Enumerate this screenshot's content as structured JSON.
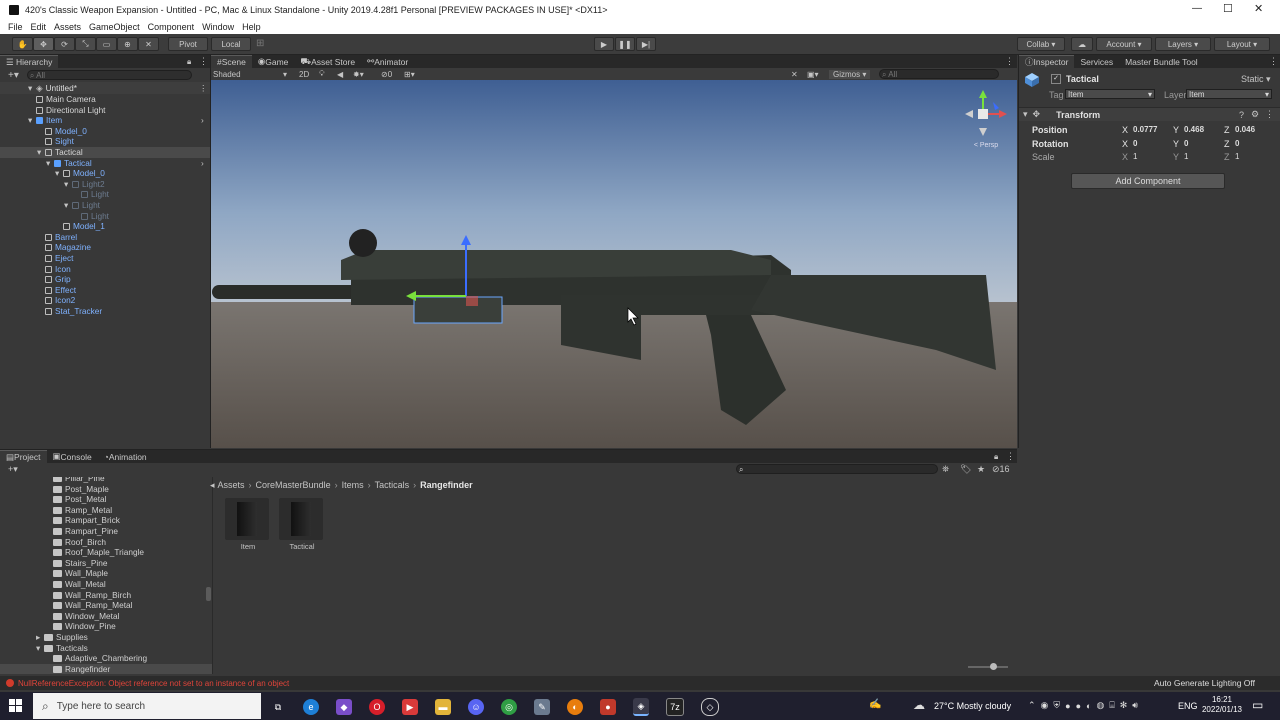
{
  "window": {
    "title": "420's Classic Weapon Expansion - Untitled - PC, Mac & Linux Standalone - Unity 2019.4.28f1 Personal [PREVIEW PACKAGES IN USE]* <DX11>",
    "controls": {
      "minimize": "—",
      "maximize": "☐",
      "close": "✕"
    }
  },
  "menu": [
    "File",
    "Edit",
    "Assets",
    "GameObject",
    "Component",
    "Window",
    "Help"
  ],
  "toolbar": {
    "pivot": "Pivot",
    "local": "Local",
    "collab": "Collab ▾",
    "services": "☁",
    "account": "Account",
    "layers": "Layers",
    "layout": "Layout"
  },
  "hierarchy": {
    "tab": "Hierarchy",
    "search_placeholder": "All",
    "scene": "Untitled*",
    "items": [
      {
        "label": "Main Camera",
        "indent": 1,
        "color": "white",
        "icon": "camera"
      },
      {
        "label": "Directional Light",
        "indent": 1,
        "color": "white",
        "icon": "cube"
      },
      {
        "label": "Item",
        "indent": 1,
        "color": "blue",
        "icon": "prefab",
        "expand": "▾",
        "arrow": "›"
      },
      {
        "label": "Model_0",
        "indent": 2,
        "color": "blue",
        "icon": "cube"
      },
      {
        "label": "Sight",
        "indent": 2,
        "color": "blue",
        "icon": "cube"
      },
      {
        "label": "Tactical",
        "indent": 2,
        "color": "white",
        "icon": "cube",
        "expand": "▾",
        "selected": true
      },
      {
        "label": "Tactical",
        "indent": 3,
        "color": "blue",
        "icon": "prefab",
        "expand": "▾",
        "arrow": "›"
      },
      {
        "label": "Model_0",
        "indent": 4,
        "color": "blue",
        "icon": "cube",
        "expand": "▾"
      },
      {
        "label": "Light2",
        "indent": 5,
        "color": "dim",
        "icon": "cube",
        "expand": "▾"
      },
      {
        "label": "Light",
        "indent": 6,
        "color": "dim",
        "icon": "cube"
      },
      {
        "label": "Light",
        "indent": 5,
        "color": "dim",
        "icon": "cube",
        "expand": "▾"
      },
      {
        "label": "Light",
        "indent": 6,
        "color": "dim",
        "icon": "cube"
      },
      {
        "label": "Model_1",
        "indent": 4,
        "color": "blue",
        "icon": "cube"
      },
      {
        "label": "Barrel",
        "indent": 2,
        "color": "blue",
        "icon": "cube"
      },
      {
        "label": "Magazine",
        "indent": 2,
        "color": "blue",
        "icon": "cube"
      },
      {
        "label": "Eject",
        "indent": 2,
        "color": "blue",
        "icon": "cube"
      },
      {
        "label": "Icon",
        "indent": 2,
        "color": "blue",
        "icon": "cube"
      },
      {
        "label": "Grip",
        "indent": 2,
        "color": "blue",
        "icon": "cube"
      },
      {
        "label": "Effect",
        "indent": 2,
        "color": "blue",
        "icon": "cube"
      },
      {
        "label": "Icon2",
        "indent": 2,
        "color": "blue",
        "icon": "cube"
      },
      {
        "label": "Stat_Tracker",
        "indent": 2,
        "color": "blue",
        "icon": "cube"
      }
    ]
  },
  "scene": {
    "tabs": [
      "Scene",
      "Game",
      "Asset Store",
      "Animator"
    ],
    "shading": "Shaded",
    "mode_2d": "2D",
    "fx_count": "0",
    "gizmos": "Gizmos",
    "search_placeholder": "All",
    "persp": "< Persp",
    "gizmo_axes": {
      "x": "x",
      "y": "y",
      "z": "z"
    }
  },
  "inspector": {
    "tabs": [
      "Inspector",
      "Services",
      "Master Bundle Tool"
    ],
    "object_name": "Tactical",
    "static_label": "Static ▾",
    "tag_label": "Tag",
    "tag_value": "Item",
    "layer_label": "Layer",
    "layer_value": "Item",
    "component": "Transform",
    "position": {
      "label": "Position",
      "x": "0.0777",
      "y": "0.468",
      "z": "0.046"
    },
    "rotation": {
      "label": "Rotation",
      "x": "0",
      "y": "0",
      "z": "0"
    },
    "scale": {
      "label": "Scale",
      "x": "1",
      "y": "1",
      "z": "1"
    },
    "axis_labels": {
      "x": "X",
      "y": "Y",
      "z": "Z"
    },
    "add_component": "Add Component"
  },
  "project": {
    "tabs": [
      "Project",
      "Console",
      "Animation"
    ],
    "breadcrumb": [
      "Assets",
      "CoreMasterBundle",
      "Items",
      "Tacticals",
      "Rangefinder"
    ],
    "breadcrumb_sep": "›",
    "hidden_count": "16",
    "folders": [
      {
        "label": "Pillar_Pine",
        "indent": 2
      },
      {
        "label": "Post_Maple",
        "indent": 2
      },
      {
        "label": "Post_Metal",
        "indent": 2
      },
      {
        "label": "Ramp_Metal",
        "indent": 2
      },
      {
        "label": "Rampart_Brick",
        "indent": 2
      },
      {
        "label": "Rampart_Pine",
        "indent": 2
      },
      {
        "label": "Roof_Birch",
        "indent": 2
      },
      {
        "label": "Roof_Maple_Triangle",
        "indent": 2
      },
      {
        "label": "Stairs_Pine",
        "indent": 2
      },
      {
        "label": "Wall_Maple",
        "indent": 2
      },
      {
        "label": "Wall_Metal",
        "indent": 2
      },
      {
        "label": "Wall_Ramp_Birch",
        "indent": 2
      },
      {
        "label": "Wall_Ramp_Metal",
        "indent": 2
      },
      {
        "label": "Window_Metal",
        "indent": 2
      },
      {
        "label": "Window_Pine",
        "indent": 2
      },
      {
        "label": "Supplies",
        "indent": 1,
        "expand": "▸"
      },
      {
        "label": "Tacticals",
        "indent": 1,
        "expand": "▾"
      },
      {
        "label": "Adaptive_Chambering",
        "indent": 2
      },
      {
        "label": "Rangefinder",
        "indent": 2,
        "selected": true
      }
    ],
    "assets": [
      "Item",
      "Tactical"
    ]
  },
  "status": {
    "error": "NullReferenceException: Object reference not set to an instance of an object",
    "lighting": "Auto Generate Lighting Off"
  },
  "taskbar": {
    "search_placeholder": "Type here to search",
    "weather": "27°C  Mostly cloudy",
    "lang": "ENG",
    "time": "16:21",
    "date": "2022/01/13",
    "colors": {
      "bg": "#1f1f2e",
      "accent": "#e04b3c"
    }
  }
}
